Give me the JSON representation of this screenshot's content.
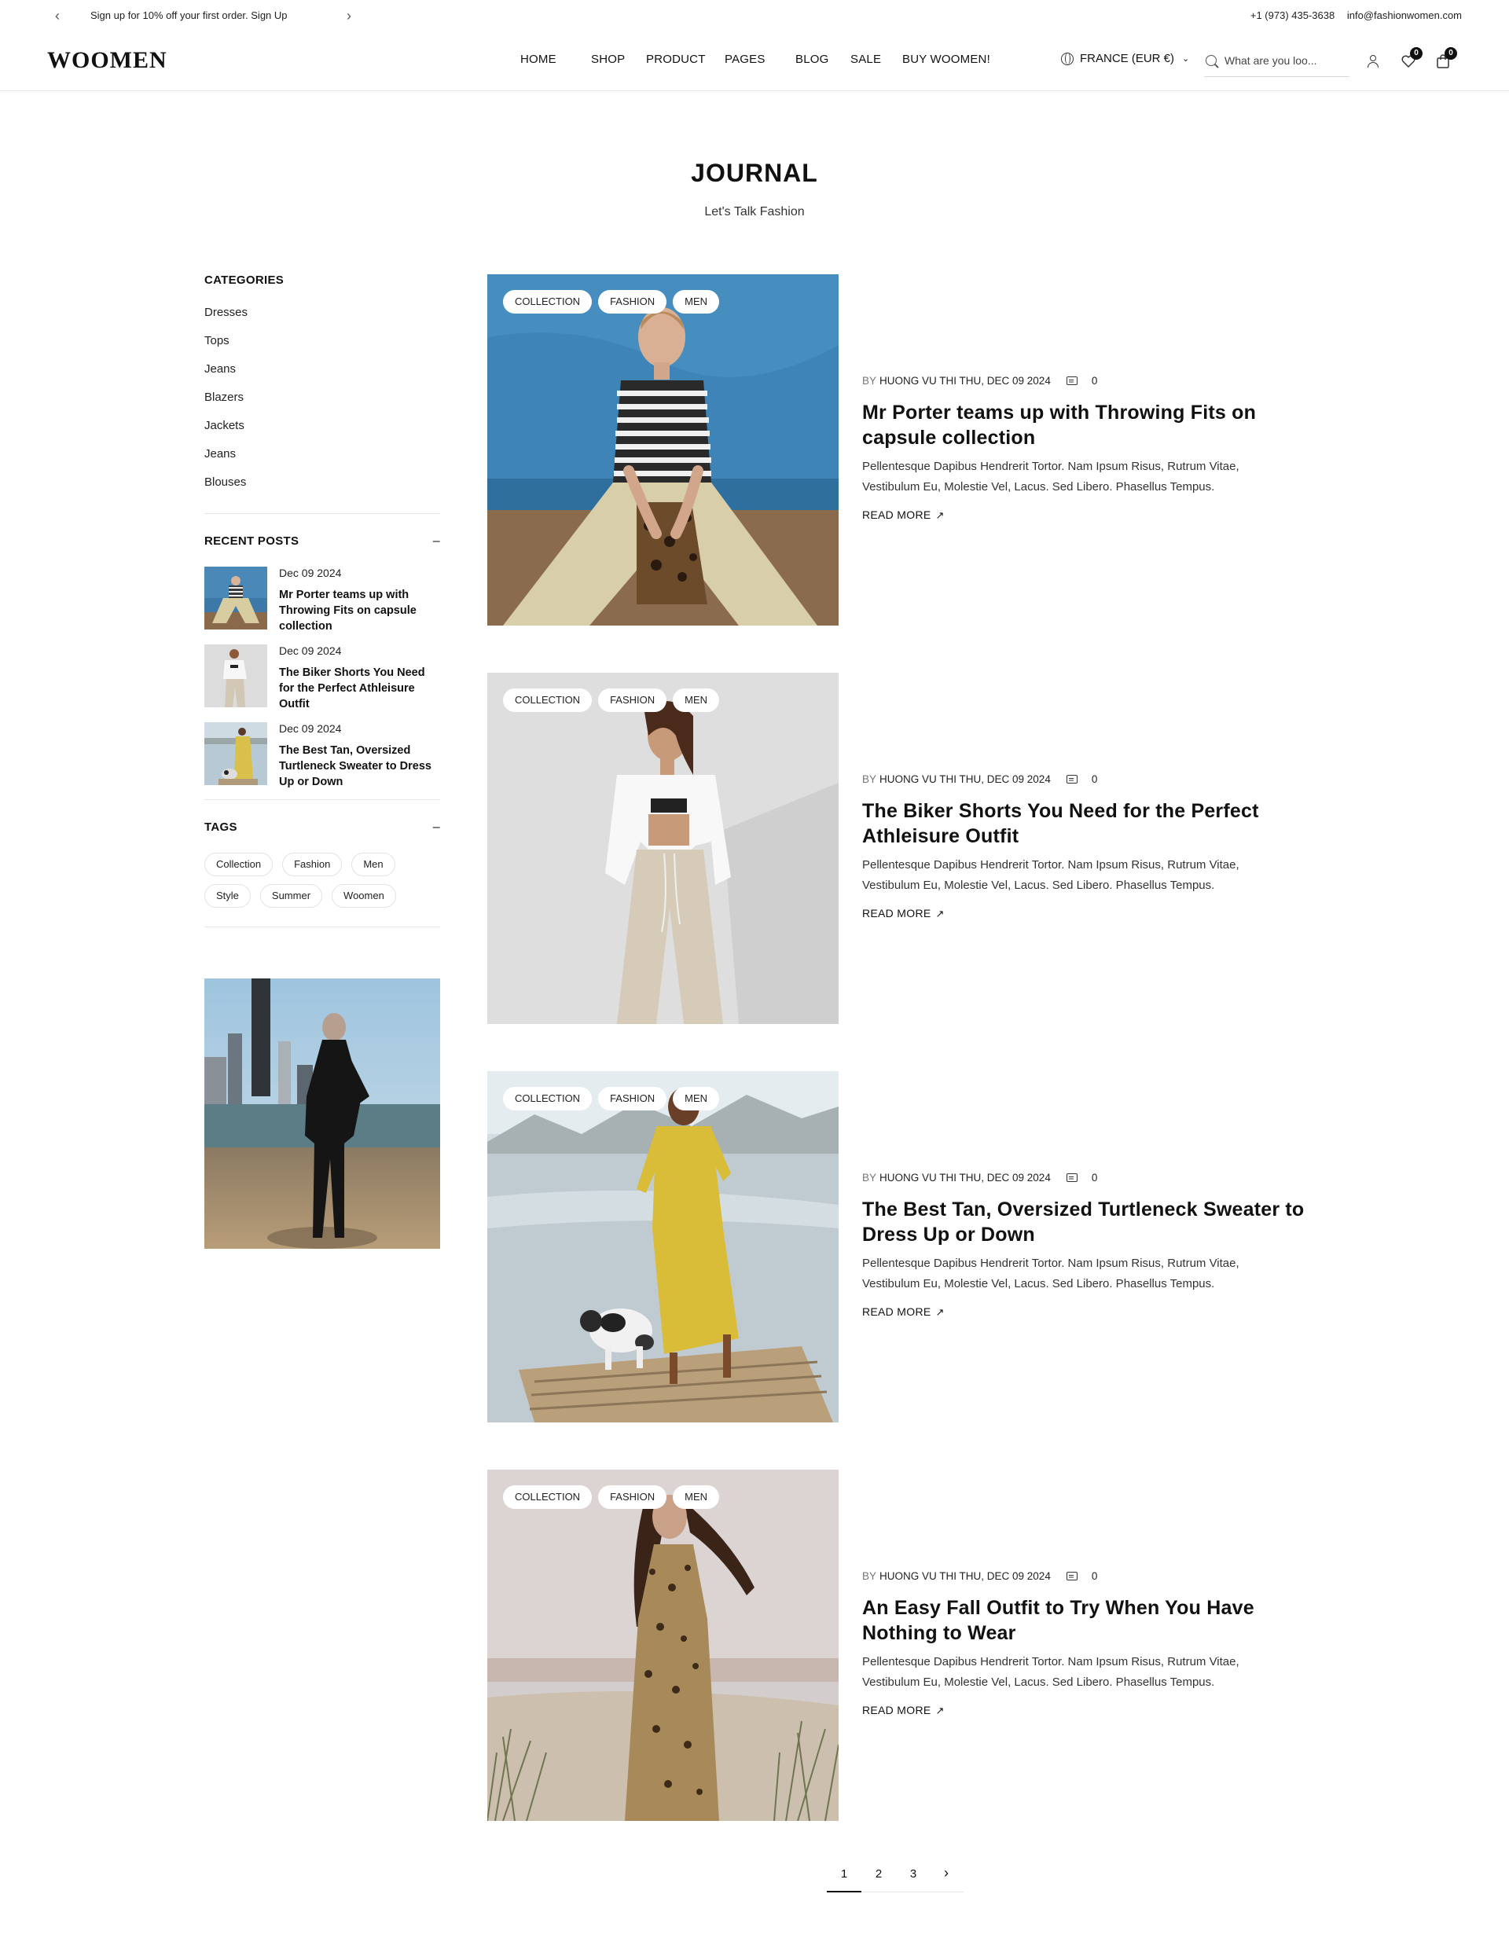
{
  "topbar": {
    "promo": "Sign up for 10% off your first order. Sign Up",
    "phone": "+1 (973) 435-3638",
    "email": "info@fashionwomen.com"
  },
  "header": {
    "logo": "WOOMEN",
    "nav": [
      "HOME",
      "SHOP",
      "PRODUCT",
      "PAGES",
      "BLOG",
      "SALE",
      "BUY WOOMEN!"
    ],
    "locale": "FRANCE (EUR €)",
    "search_placeholder": "What are you loo...",
    "wishlist_count": "0",
    "cart_count": "0"
  },
  "page": {
    "title": "JOURNAL",
    "subtitle": "Let's Talk Fashion"
  },
  "sidebar": {
    "categories_heading": "CATEGORIES",
    "categories": [
      "Dresses",
      "Tops",
      "Jeans",
      "Blazers",
      "Jackets",
      "Jeans",
      "Blouses"
    ],
    "recent_heading": "RECENT POSTS",
    "recent_posts": [
      {
        "date": "Dec 09 2024",
        "title": "Mr Porter teams up with Throwing Fits on capsule collection"
      },
      {
        "date": "Dec 09 2024",
        "title": "The Biker Shorts You Need for the Perfect Athleisure Outfit"
      },
      {
        "date": "Dec 09 2024",
        "title": "The Best Tan, Oversized Turtleneck Sweater to Dress Up or Down"
      }
    ],
    "tags_heading": "TAGS",
    "tags": [
      "Collection",
      "Fashion",
      "Men",
      "Style",
      "Summer",
      "Woomen"
    ],
    "collapse_symbol": "–"
  },
  "posts": [
    {
      "chips": [
        "COLLECTION",
        "FASHION",
        "MEN"
      ],
      "by": "BY",
      "author_date": "HUONG VU THI THU, DEC 09 2024",
      "comments": "0",
      "title": "Mr Porter teams up with Throwing Fits on capsule collection",
      "excerpt": "Pellentesque Dapibus Hendrerit Tortor. Nam Ipsum Risus, Rutrum Vitae, Vestibulum Eu, Molestie Vel, Lacus. Sed Libero. Phasellus Tempus.",
      "read_more": "READ MORE"
    },
    {
      "chips": [
        "COLLECTION",
        "FASHION",
        "MEN"
      ],
      "by": "BY",
      "author_date": "HUONG VU THI THU, DEC 09 2024",
      "comments": "0",
      "title": "The Biker Shorts You Need for the Perfect Athleisure Outfit",
      "excerpt": "Pellentesque Dapibus Hendrerit Tortor. Nam Ipsum Risus, Rutrum Vitae, Vestibulum Eu, Molestie Vel, Lacus. Sed Libero. Phasellus Tempus.",
      "read_more": "READ MORE"
    },
    {
      "chips": [
        "COLLECTION",
        "FASHION",
        "MEN"
      ],
      "by": "BY",
      "author_date": "HUONG VU THI THU, DEC 09 2024",
      "comments": "0",
      "title": "The Best Tan, Oversized Turtleneck Sweater to Dress Up or Down",
      "excerpt": "Pellentesque Dapibus Hendrerit Tortor. Nam Ipsum Risus, Rutrum Vitae, Vestibulum Eu, Molestie Vel, Lacus. Sed Libero. Phasellus Tempus.",
      "read_more": "READ MORE"
    },
    {
      "chips": [
        "COLLECTION",
        "FASHION",
        "MEN"
      ],
      "by": "BY",
      "author_date": "HUONG VU THI THU, DEC 09 2024",
      "comments": "0",
      "title": "An Easy Fall Outfit to Try When You Have Nothing to Wear",
      "excerpt": "Pellentesque Dapibus Hendrerit Tortor. Nam Ipsum Risus, Rutrum Vitae, Vestibulum Eu, Molestie Vel, Lacus. Sed Libero. Phasellus Tempus.",
      "read_more": "READ MORE"
    }
  ],
  "pagination": {
    "pages": [
      "1",
      "2",
      "3"
    ],
    "next": "›",
    "current": "1"
  },
  "icons": {
    "prev": "chevron-left-icon",
    "next": "chevron-right-icon",
    "locale": "globe-icon",
    "search": "search-icon",
    "account": "user-icon",
    "wishlist": "heart-icon",
    "cart": "shopping-bag-icon",
    "comment": "comment-icon",
    "read_more": "arrow-up-right-icon"
  },
  "colors": {
    "text": "#111111",
    "border": "#e6e6e6",
    "badge": "#111111"
  }
}
